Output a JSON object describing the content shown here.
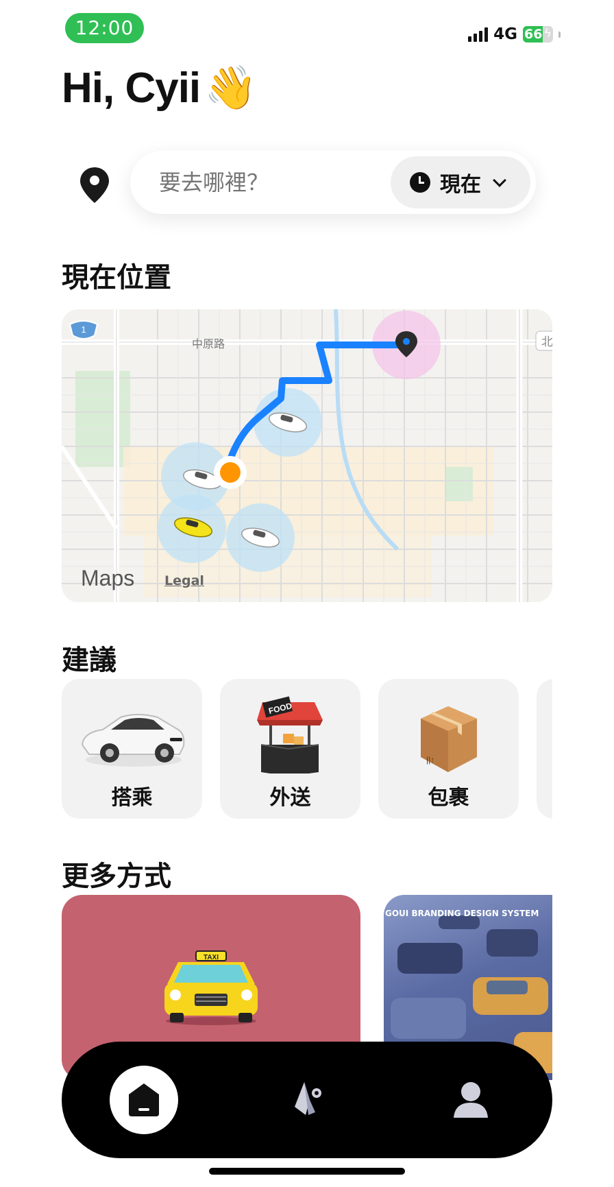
{
  "status_bar": {
    "time": "12:00",
    "network": "4G",
    "battery_percent": "66",
    "battery_level": 0.66,
    "signal_bars": 4
  },
  "greeting": {
    "text": "Hi, Cyii",
    "emoji": "👋"
  },
  "search": {
    "placeholder": "要去哪裡？",
    "time_option": "現在"
  },
  "current_location": {
    "title": "現在位置",
    "map": {
      "road_label": "中原路",
      "route_shield": "1",
      "edge_label": "北",
      "attribution": "Maps",
      "legal": "Legal",
      "route_color": "#1a82ff",
      "origin_color": "#ff9500",
      "destination_halo_color": "#f3c2ea",
      "car_halo_color": "#bfe1f7"
    }
  },
  "suggestions": {
    "title": "建議",
    "items": [
      {
        "label": "搭乘",
        "icon": "car-icon"
      },
      {
        "label": "外送",
        "icon": "food-stall-icon",
        "sign": "FOOD"
      },
      {
        "label": "包裹",
        "icon": "package-icon"
      }
    ]
  },
  "more_ways": {
    "title": "更多方式",
    "cards": [
      {
        "name": "taxi",
        "sign": "TAXI",
        "bg": "#c4626f"
      },
      {
        "name": "branding",
        "text": "GOUI BRANDING DESIGN SYSTEM"
      }
    ]
  },
  "tabbar": {
    "tabs": [
      {
        "name": "home",
        "icon": "home-icon",
        "active": true
      },
      {
        "name": "activity",
        "icon": "activity-icon",
        "active": false
      },
      {
        "name": "profile",
        "icon": "person-icon",
        "active": false
      }
    ]
  }
}
